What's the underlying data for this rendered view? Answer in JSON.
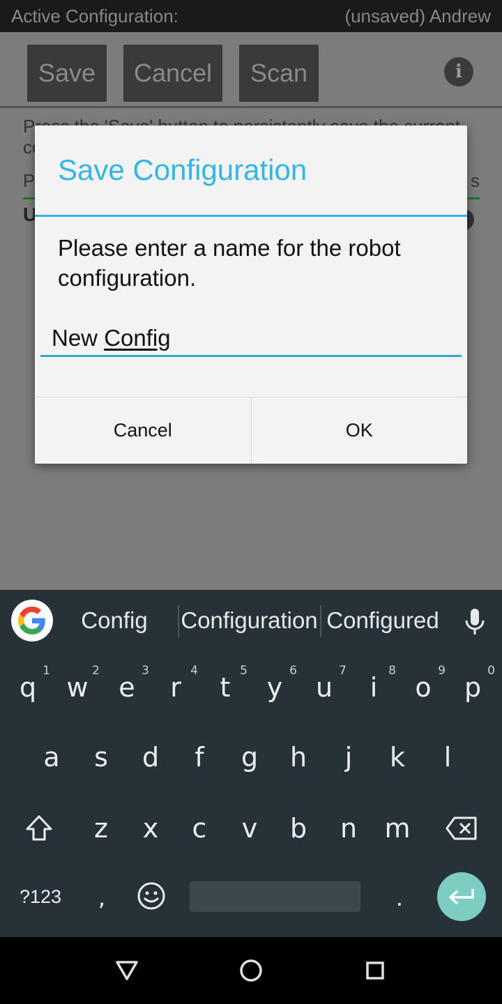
{
  "titlebar": {
    "label": "Active Configuration:",
    "value": "(unsaved) Andrew"
  },
  "app": {
    "buttons": [
      "Save",
      "Cancel",
      "Scan"
    ],
    "info_icon": "info-icon",
    "text_line1": "Press the 'Save' button to persistently save the current",
    "text_line1b": "co",
    "text_line2_left": "P",
    "text_line2_right": "s",
    "text_line3": "U"
  },
  "dialog": {
    "title": "Save Configuration",
    "message": "Please enter a name for the robot configuration.",
    "input_value_prefix": "New ",
    "input_value_underlined": "Config",
    "cancel_label": "Cancel",
    "ok_label": "OK",
    "accent_color": "#33b5e5"
  },
  "keyboard": {
    "suggestions": [
      "Config",
      "Configuration",
      "Configured"
    ],
    "row1": [
      {
        "k": "q",
        "h": "1"
      },
      {
        "k": "w",
        "h": "2"
      },
      {
        "k": "e",
        "h": "3"
      },
      {
        "k": "r",
        "h": "4"
      },
      {
        "k": "t",
        "h": "5"
      },
      {
        "k": "y",
        "h": "6"
      },
      {
        "k": "u",
        "h": "7"
      },
      {
        "k": "i",
        "h": "8"
      },
      {
        "k": "o",
        "h": "9"
      },
      {
        "k": "p",
        "h": "0"
      }
    ],
    "row2": [
      "a",
      "s",
      "d",
      "f",
      "g",
      "h",
      "j",
      "k",
      "l"
    ],
    "row3": [
      "z",
      "x",
      "c",
      "v",
      "b",
      "n",
      "m"
    ],
    "symbols_label": "?123",
    "comma": ",",
    "period": ".",
    "background": "#263238",
    "enter_color": "#7ecdc3"
  },
  "navbar": {
    "icons": [
      "back-triangle-icon",
      "home-circle-icon",
      "recents-square-icon"
    ]
  }
}
